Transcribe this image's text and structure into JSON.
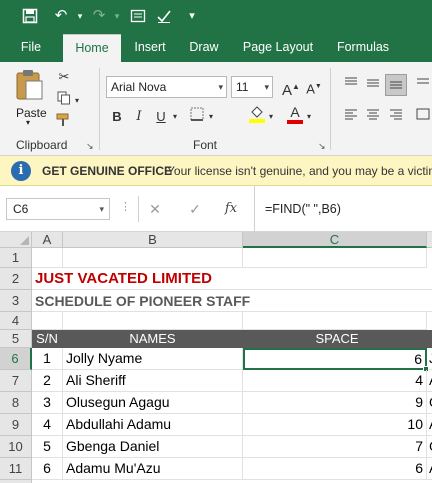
{
  "qat": {
    "save_icon": "save-icon",
    "undo_icon": "undo-icon",
    "redo_icon": "redo-icon",
    "form_icon": "form-icon",
    "check_icon": "checkmark-icon",
    "more_icon": "customize-icon"
  },
  "tabs": [
    "File",
    "Home",
    "Insert",
    "Draw",
    "Page Layout",
    "Formulas"
  ],
  "ribbon": {
    "paste_label": "Paste",
    "clipboard_label": "Clipboard",
    "font_label": "Font",
    "font_name": "Arial Nova",
    "font_size": "11",
    "bold": "B",
    "italic": "I",
    "underline": "U",
    "grow_font": "A",
    "shrink_font": "A",
    "font_color_letter": "A"
  },
  "message_bar": {
    "title": "GET GENUINE OFFICE",
    "text": "Your license isn't genuine, and you may be a victim of software counterfeiting."
  },
  "formula_bar": {
    "name_box": "C6",
    "fx": "fx",
    "formula": "=FIND(\" \",B6)"
  },
  "columns": [
    "A",
    "B",
    "C"
  ],
  "rows": [
    "1",
    "2",
    "3",
    "4",
    "5",
    "6",
    "7",
    "8",
    "9",
    "10",
    "11"
  ],
  "sheet": {
    "title": "JUST VACATED LIMITED",
    "subtitle": "SCHEDULE OF PIONEER STAFF",
    "headers": [
      "S/N",
      "NAMES",
      "SPACE"
    ],
    "data": [
      {
        "sn": "1",
        "name": "Jolly Nyame",
        "space": "6",
        "d": "J"
      },
      {
        "sn": "2",
        "name": "Ali Sheriff",
        "space": "4",
        "d": "A"
      },
      {
        "sn": "3",
        "name": "Olusegun Agagu",
        "space": "9",
        "d": "O"
      },
      {
        "sn": "4",
        "name": "Abdullahi Adamu",
        "space": "10",
        "d": "A"
      },
      {
        "sn": "5",
        "name": "Gbenga Daniel",
        "space": "7",
        "d": "G"
      },
      {
        "sn": "6",
        "name": "Adamu Mu'Azu",
        "space": "6",
        "d": "A"
      }
    ]
  },
  "colors": {
    "excel_green": "#217346",
    "title_red": "#c00000",
    "header_gray": "#595959",
    "message_yellow": "#fdf6c3"
  }
}
